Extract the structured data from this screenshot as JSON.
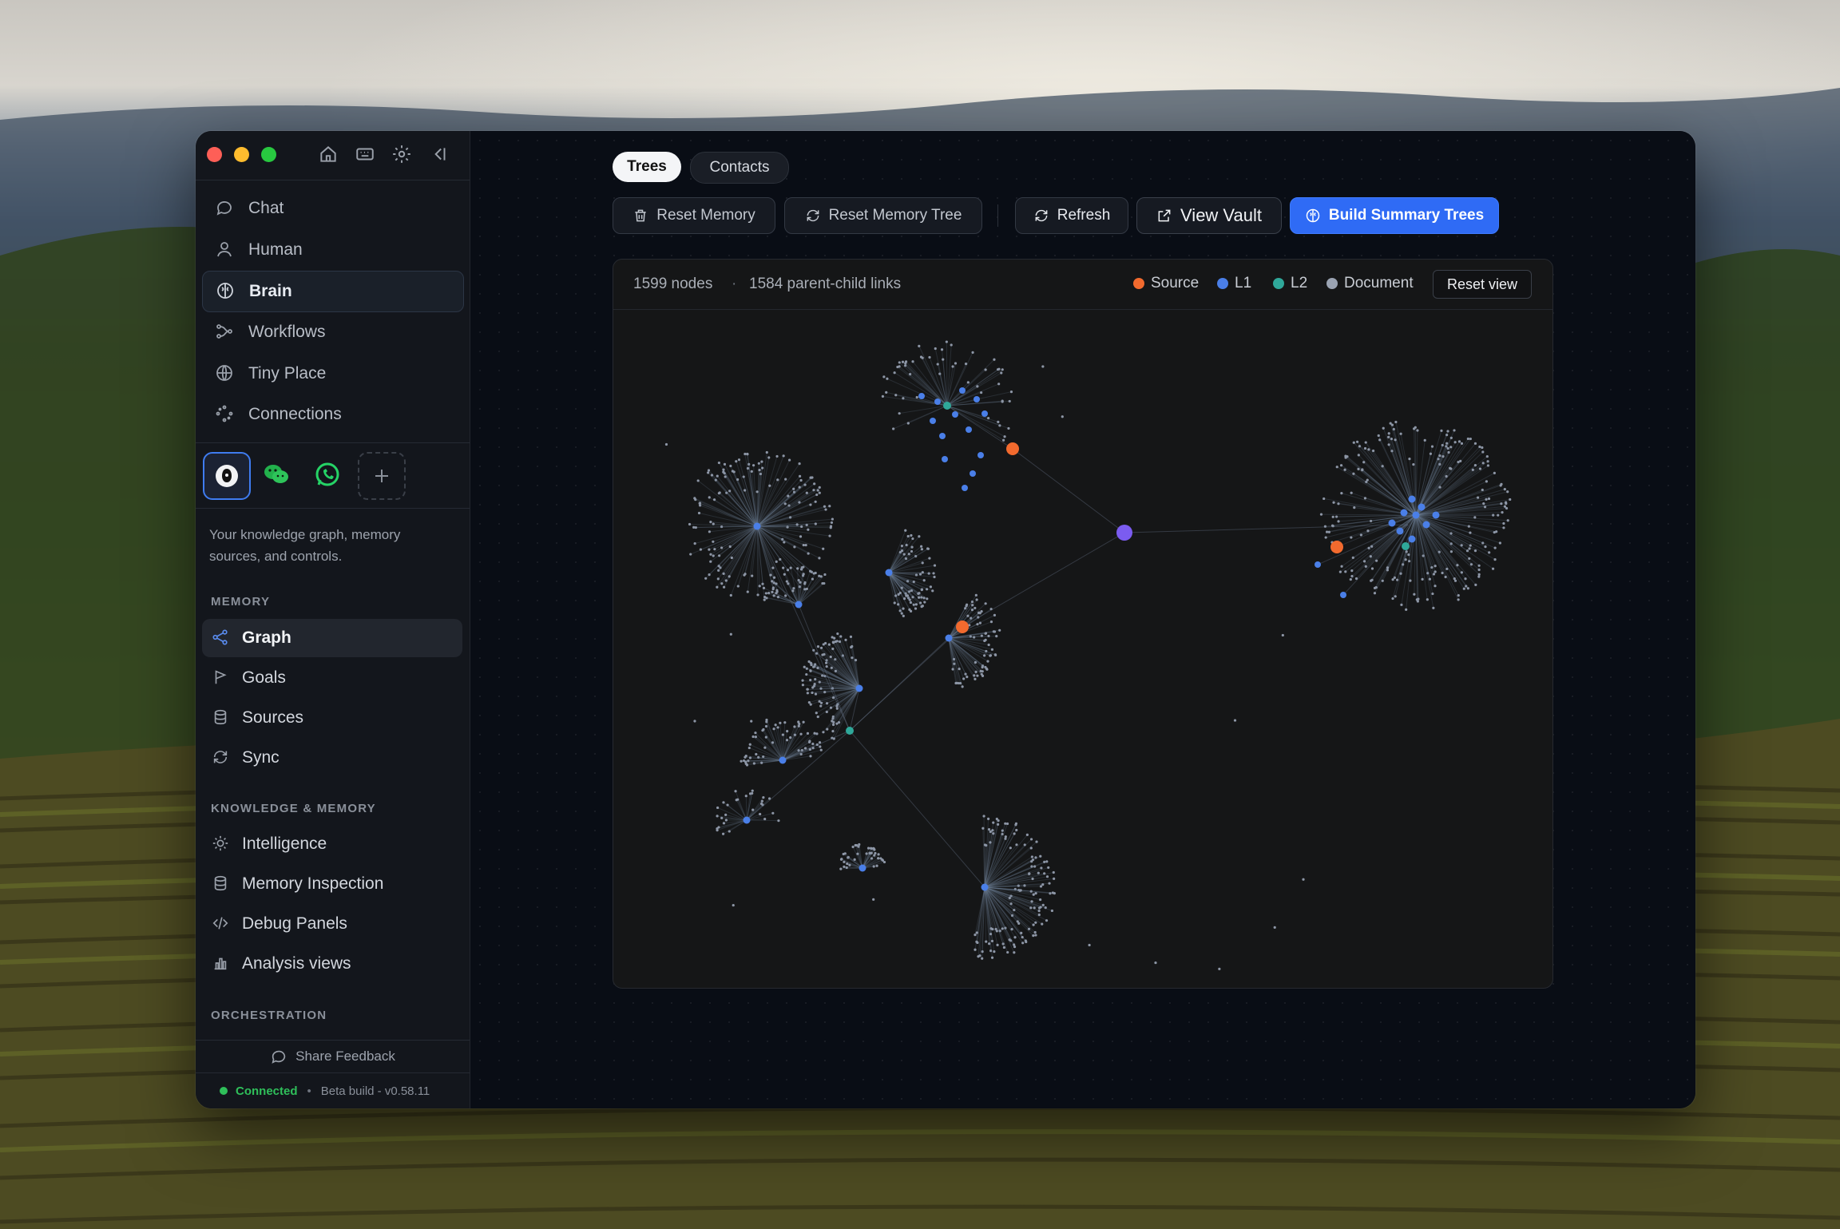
{
  "window": {
    "titlebar_icons": [
      "home-icon",
      "keyboard-icon",
      "gear-icon",
      "collapse-sidebar-icon"
    ]
  },
  "sidebar": {
    "nav": [
      {
        "label": "Chat",
        "icon": "chat-bubble-icon"
      },
      {
        "label": "Human",
        "icon": "person-icon"
      },
      {
        "label": "Brain",
        "icon": "brain-icon",
        "active": true
      },
      {
        "label": "Workflows",
        "icon": "workflow-icon"
      },
      {
        "label": "Tiny Place",
        "icon": "globe-icon"
      },
      {
        "label": "Connections",
        "icon": "connections-icon"
      }
    ],
    "channels": [
      "app-logo-icon",
      "wechat-icon",
      "whatsapp-icon",
      "add-icon"
    ],
    "description": "Your knowledge graph, memory sources, and controls.",
    "sections": {
      "memory": {
        "title": "MEMORY",
        "items": [
          {
            "label": "Graph",
            "icon": "graph-icon",
            "active": true
          },
          {
            "label": "Goals",
            "icon": "flag-icon"
          },
          {
            "label": "Sources",
            "icon": "database-icon"
          },
          {
            "label": "Sync",
            "icon": "sync-icon"
          }
        ]
      },
      "knowledge": {
        "title": "KNOWLEDGE & MEMORY",
        "items": [
          {
            "label": "Intelligence",
            "icon": "lightbulb-icon"
          },
          {
            "label": "Memory Inspection",
            "icon": "database-icon"
          },
          {
            "label": "Debug Panels",
            "icon": "code-icon"
          },
          {
            "label": "Analysis views",
            "icon": "bar-chart-icon"
          }
        ]
      },
      "orchestration": {
        "title": "ORCHESTRATION"
      }
    },
    "footer": {
      "feedback": "Share Feedback",
      "status": "Connected",
      "build": "Beta build - v0.58.11",
      "status_color": "#2fbf5a"
    }
  },
  "main": {
    "tabs": [
      {
        "label": "Trees",
        "active": true
      },
      {
        "label": "Contacts"
      }
    ],
    "toolbar": {
      "reset_memory": "Reset Memory",
      "reset_memory_tree": "Reset Memory Tree",
      "refresh": "Refresh",
      "view_vault": "View Vault",
      "build_summary_trees": "Build Summary Trees",
      "accent": "#2f6bf5"
    },
    "graph": {
      "nodes_count": "1599 nodes",
      "links_count": "1584 parent-child links",
      "legend": [
        {
          "label": "Source",
          "color": "#f26a2e"
        },
        {
          "label": "L1",
          "color": "#4a7fe8"
        },
        {
          "label": "L2",
          "color": "#2fa89a"
        },
        {
          "label": "Document",
          "color": "#9aa3b2"
        }
      ],
      "reset_view": "Reset view"
    }
  }
}
